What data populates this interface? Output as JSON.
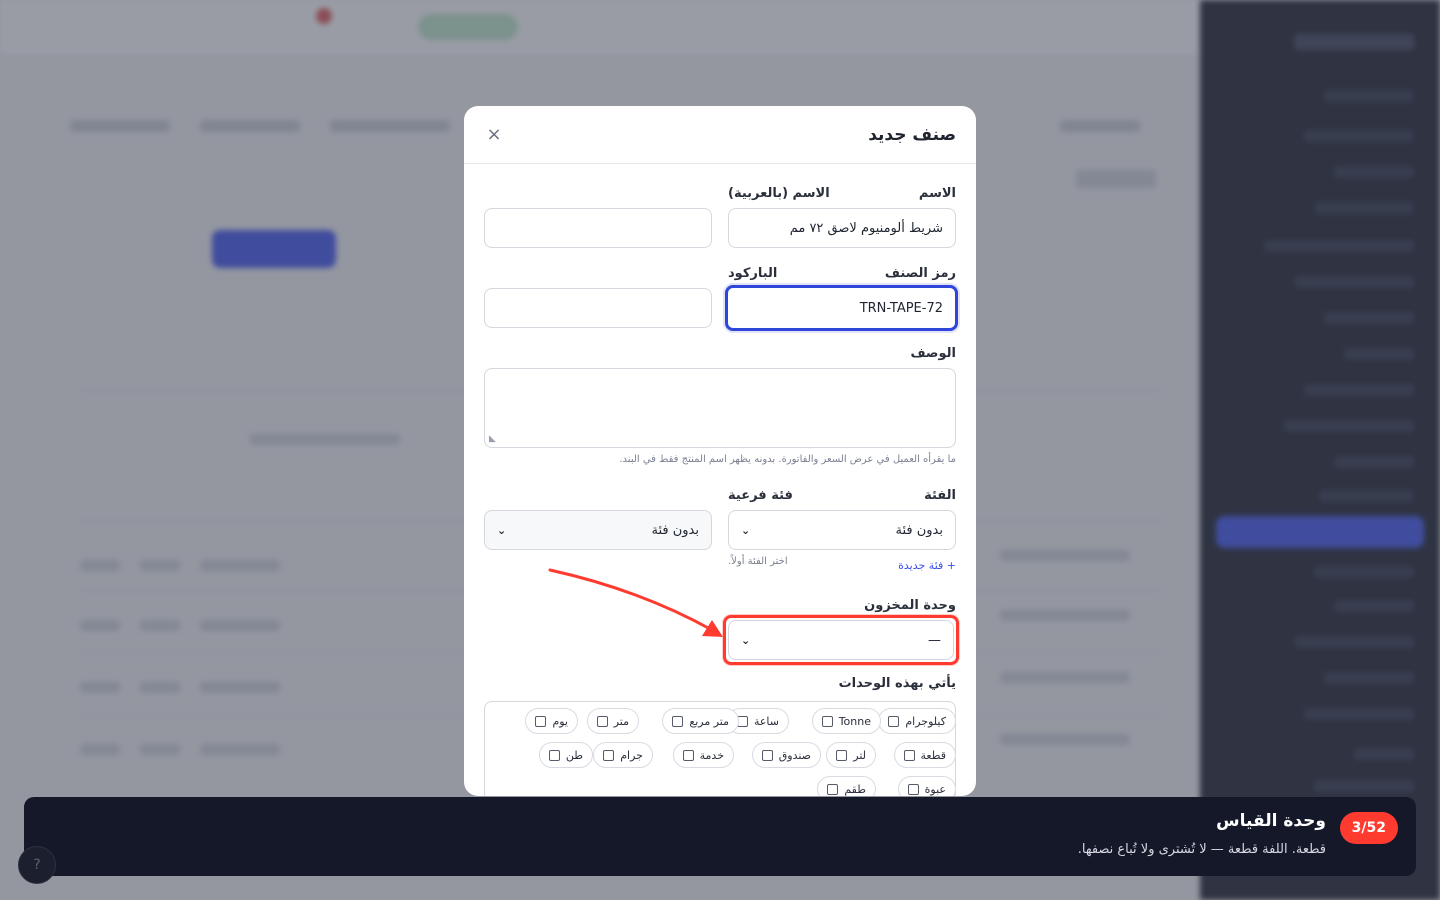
{
  "modal": {
    "title": "صنف جديد",
    "close_symbol": "×",
    "name_label": "الاسم",
    "name_value": "شريط ألومنيوم لاصق ٧٢ مم",
    "name_ar_label": "الاسم (بالعربية)",
    "name_ar_value": "",
    "sku_label": "رمز الصنف",
    "sku_value": "TRN-TAPE-72",
    "barcode_label": "الباركود",
    "barcode_value": "",
    "description_label": "الوصف",
    "description_hint": "ما يقرأه العميل في عرض السعر والفاتورة. بدونه يظهر اسم المنتج فقط في البند.",
    "category_label": "الفئة",
    "category_value": "بدون فئة",
    "subcategory_label": "فئة فرعية",
    "subcategory_value": "بدون فئة",
    "subcategory_hint": "اختر الفئة أولاً.",
    "new_category_link": "+ فئة جديدة",
    "stock_unit_label": "وحدة المخزون",
    "stock_unit_value": "—",
    "units_label": "يأتي بهذه الوحدات",
    "units": [
      {
        "label": "كيلوجرام",
        "checked": false
      },
      {
        "label": "Tonne",
        "checked": false
      },
      {
        "label": "ساعة",
        "checked": false
      },
      {
        "label": "متر مربع",
        "checked": false
      },
      {
        "label": "متر",
        "checked": false
      },
      {
        "label": "يوم",
        "checked": false
      },
      {
        "label": "قطعة",
        "checked": false
      },
      {
        "label": "لتر",
        "checked": false
      },
      {
        "label": "صندوق",
        "checked": false
      },
      {
        "label": "خدمة",
        "checked": false
      },
      {
        "label": "جرام",
        "checked": false
      },
      {
        "label": "طن",
        "checked": false
      },
      {
        "label": "عبوة",
        "checked": false
      },
      {
        "label": "طقم",
        "checked": false
      }
    ]
  },
  "tour": {
    "counter": "3/52",
    "title": "وحدة القياس",
    "body": "قطعة. اللفة قطعة — لا تُشترى ولا تُباع نصفها."
  },
  "colors": {
    "accent": "#3b4ff0",
    "focus": "#2f46d8",
    "highlight": "#ff3b30",
    "tour_bg": "#141829"
  }
}
